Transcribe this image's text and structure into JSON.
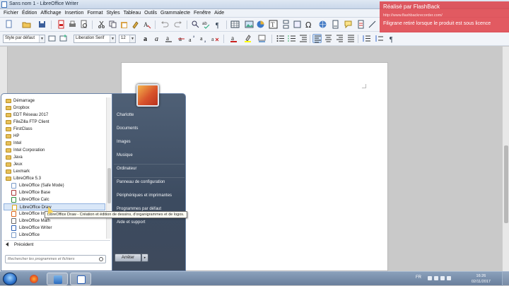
{
  "window": {
    "title": "Sans nom 1 - LibreOffice Writer"
  },
  "menu": [
    "Fichier",
    "Édition",
    "Affichage",
    "Insertion",
    "Format",
    "Styles",
    "Tableau",
    "Outils",
    "Grammalecte",
    "Fenêtre",
    "Aide"
  ],
  "formatting": {
    "paragraph_style": "Style par défaut",
    "font_name": "Liberation Serif",
    "font_size": "12"
  },
  "watermark": {
    "title": "Réalisé par FlashBack",
    "url": "http://www.flashbackrecorder.com/",
    "message": "Filigrane retiré lorsque le produit est sous licence"
  },
  "start_menu": {
    "programs": [
      {
        "label": "Démarrage",
        "type": "folder"
      },
      {
        "label": "Dropbox",
        "type": "folder"
      },
      {
        "label": "EDT Réseau 2017",
        "type": "folder"
      },
      {
        "label": "FileZilla FTP Client",
        "type": "folder"
      },
      {
        "label": "FirstClass",
        "type": "folder"
      },
      {
        "label": "HP",
        "type": "folder"
      },
      {
        "label": "Intel",
        "type": "folder"
      },
      {
        "label": "Intel Corporation",
        "type": "folder"
      },
      {
        "label": "Java",
        "type": "folder"
      },
      {
        "label": "Jeux",
        "type": "folder"
      },
      {
        "label": "Lexmark",
        "type": "folder"
      },
      {
        "label": "LibreOffice 5.3",
        "type": "folder"
      },
      {
        "label": "LibreOffice (Safe Mode)",
        "type": "app"
      },
      {
        "label": "LibreOffice Base",
        "type": "app"
      },
      {
        "label": "LibreOffice Calc",
        "type": "app"
      },
      {
        "label": "LibreOffice Draw",
        "type": "app",
        "hover": true
      },
      {
        "label": "LibreOffice Impress",
        "type": "app"
      },
      {
        "label": "LibreOffice Math",
        "type": "app"
      },
      {
        "label": "LibreOffice Writer",
        "type": "app"
      },
      {
        "label": "LibreOffice",
        "type": "app"
      }
    ],
    "back_label": "Précédent",
    "search_placeholder": "Rechercher les programmes et fichiers",
    "places": [
      "Charlotte",
      "Documents",
      "Images",
      "Musique",
      "Ordinateur",
      "Panneau de configuration",
      "Périphériques et imprimantes",
      "Programmes par défaut",
      "Aide et support"
    ],
    "shutdown_label": "Arrêter",
    "tooltip": "LibreOffice Draw - Création et édition de dessins, d'organigrammes et de logos."
  },
  "taskbar": {
    "language": "FR",
    "time": "16:26",
    "date": "02/11/2017"
  }
}
